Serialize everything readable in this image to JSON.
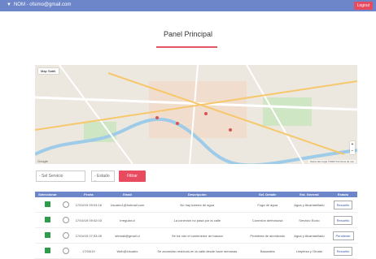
{
  "topbar": {
    "user_label": "NOM - ofsimo@gmail.com",
    "logout_label": "Logout"
  },
  "page": {
    "title": "Panel Principal"
  },
  "map": {
    "type_label": "Map Satél.",
    "zoom_in": "+",
    "zoom_out": "−",
    "brand": "Google",
    "footer": "Datos del mapa ©2023   Términos de uso"
  },
  "filters": {
    "search_value": "- Sel Servicio",
    "state_value": "- Estado -",
    "filter_label": "Filtrar"
  },
  "table": {
    "headers": [
      "Seleccionar",
      "",
      "Fecha",
      "Email",
      "Descripción",
      "Sel. Detalle",
      "Est. General",
      "Estado"
    ],
    "rows": [
      {
        "fecha": "17/04/19 09:03:16",
        "email": "Usuario1@hotmail.com",
        "descripcion": "No hay tubería de agua",
        "detalle": "Fuga de agua",
        "general": "Agua y Alcantarillado",
        "estado": "Resuelto"
      },
      {
        "fecha": "17/04/19 09:02:03",
        "email": "Irregular.cl",
        "descripcion": "La conexión no pasa por la calle",
        "detalle": "Conexión defectuosa",
        "general": "Servicio Ecolo",
        "estado": "Resuelto"
      },
      {
        "fecha": "17/04/19 07:53:45",
        "email": "sfemail@gmail.cl",
        "descripcion": "Se ha roto el contenedor de basura",
        "detalle": "Problema de alumbrado",
        "general": "Agua y Alcantarillado",
        "estado": "Pendiente"
      },
      {
        "fecha": "17/04/19",
        "email": "Web@Usuario",
        "descripcion": "Se acumulan residuos en la calle desde hace semanas",
        "detalle": "Basurales",
        "general": "Limpieza y Ornato",
        "estado": "Resuelto"
      }
    ]
  }
}
